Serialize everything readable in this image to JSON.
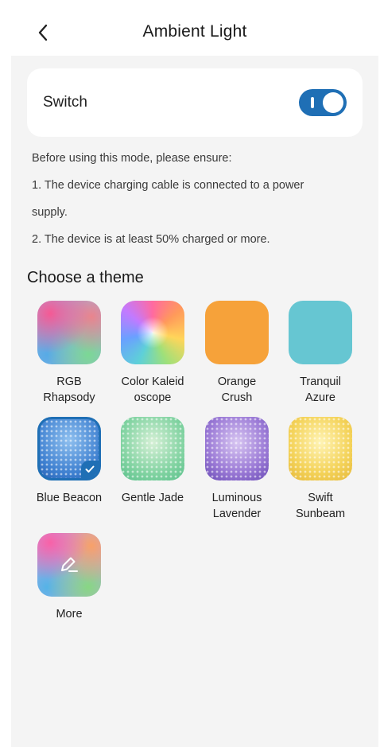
{
  "header": {
    "title": "Ambient Light",
    "back_icon": "chevron-left-icon"
  },
  "switch": {
    "label": "Switch",
    "state": "on",
    "accent_color": "#1f6fb5"
  },
  "notes": [
    "Before using this mode, please ensure:",
    "1. The device charging cable is connected to a power",
    "supply.",
    "2. The device is at least 50% charged or more."
  ],
  "themes": {
    "title": "Choose a theme",
    "items": [
      {
        "label": "RGB\nRhapsody"
      },
      {
        "label": "Color Kaleid\noscope"
      },
      {
        "label": "Orange\nCrush"
      },
      {
        "label": "Tranquil\nAzure"
      },
      {
        "label": "Blue Beacon",
        "selected": true
      },
      {
        "label": "Gentle Jade"
      },
      {
        "label": "Luminous\nLavender"
      },
      {
        "label": "Swift\nSunbeam"
      },
      {
        "label": "More",
        "icon": "edit-icon"
      }
    ]
  }
}
